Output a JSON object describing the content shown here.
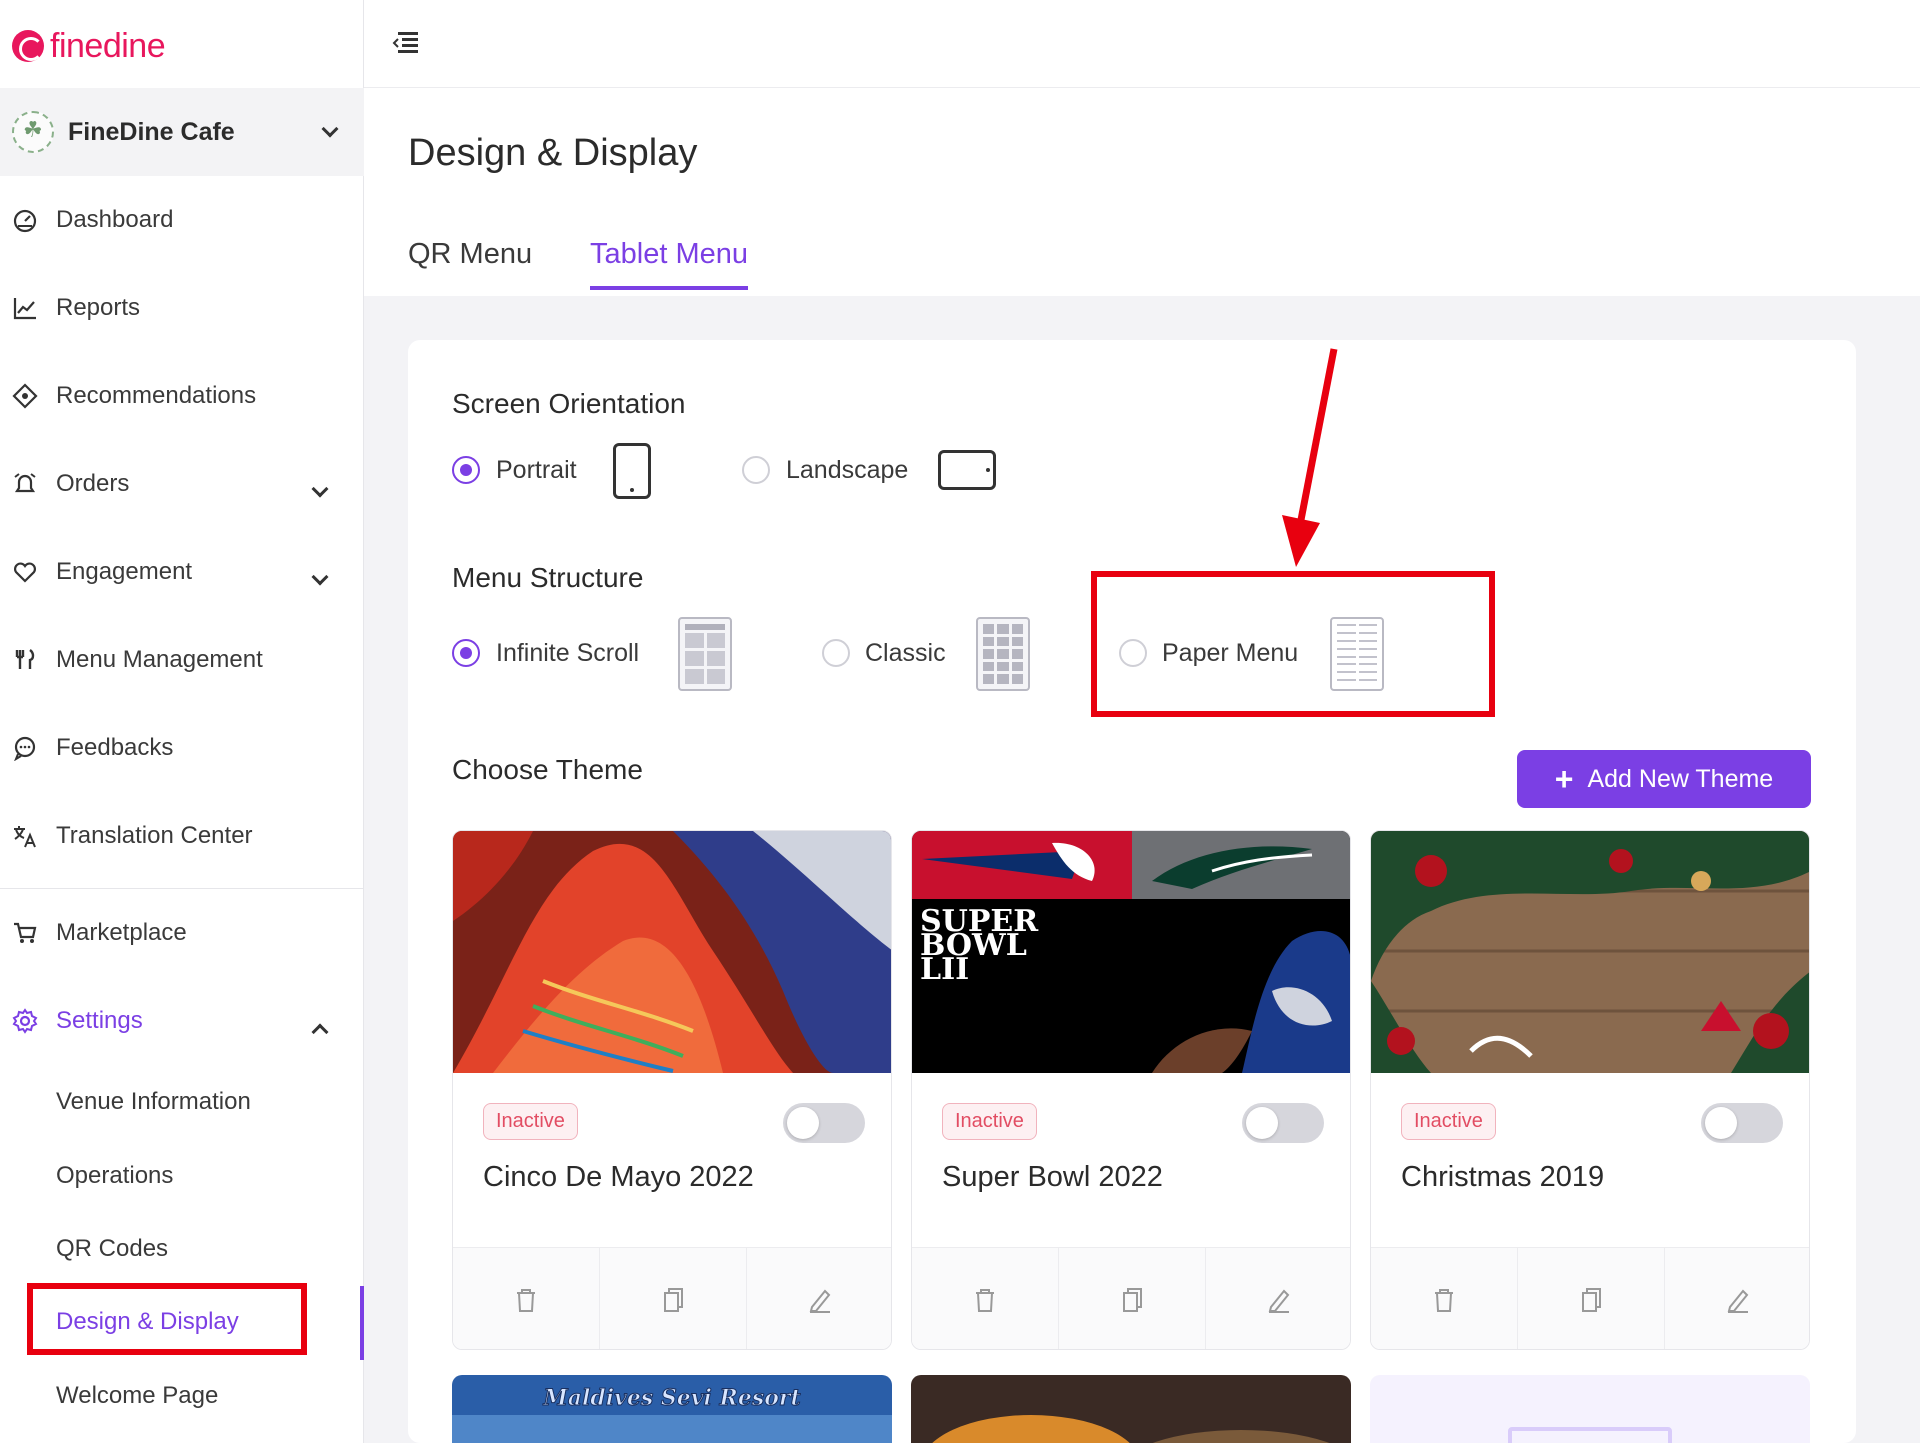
{
  "brand": {
    "name": "finedine",
    "color": "#e8175d"
  },
  "accent_color": "#7b3fe4",
  "venue": {
    "name": "FineDine Cafe"
  },
  "sidebar": {
    "items": [
      {
        "label": "Dashboard",
        "icon": "dashboard-icon"
      },
      {
        "label": "Reports",
        "icon": "chart-line-icon"
      },
      {
        "label": "Recommendations",
        "icon": "recommendations-icon"
      },
      {
        "label": "Orders",
        "icon": "bell-icon",
        "expandable": true
      },
      {
        "label": "Engagement",
        "icon": "heart-icon",
        "expandable": true
      },
      {
        "label": "Menu Management",
        "icon": "fork-knife-icon"
      },
      {
        "label": "Feedbacks",
        "icon": "chat-icon"
      },
      {
        "label": "Translation Center",
        "icon": "translate-icon"
      },
      {
        "label": "Marketplace",
        "icon": "cart-icon"
      },
      {
        "label": "Settings",
        "icon": "gear-icon",
        "expanded": true
      }
    ],
    "settings_sub": [
      {
        "label": "Venue Information"
      },
      {
        "label": "Operations"
      },
      {
        "label": "QR Codes"
      },
      {
        "label": "Design & Display",
        "active": true
      },
      {
        "label": "Welcome Page"
      }
    ]
  },
  "page": {
    "title": "Design & Display",
    "tabs": [
      {
        "label": "QR Menu",
        "active": false
      },
      {
        "label": "Tablet Menu",
        "active": true
      }
    ]
  },
  "screen_orientation": {
    "label": "Screen Orientation",
    "options": [
      {
        "label": "Portrait",
        "selected": true
      },
      {
        "label": "Landscape",
        "selected": false
      }
    ]
  },
  "menu_structure": {
    "label": "Menu Structure",
    "options": [
      {
        "label": "Infinite Scroll",
        "selected": true
      },
      {
        "label": "Classic",
        "selected": false
      },
      {
        "label": "Paper Menu",
        "selected": false
      }
    ]
  },
  "themes": {
    "label": "Choose Theme",
    "add_button": "Add New Theme",
    "items": [
      {
        "name": "Cinco De Mayo 2022",
        "status": "Inactive",
        "enabled": false
      },
      {
        "name": "Super Bowl 2022",
        "status": "Inactive",
        "enabled": false,
        "image_text": "SUPER BOWL LII"
      },
      {
        "name": "Christmas 2019",
        "status": "Inactive",
        "enabled": false
      }
    ],
    "next_row": [
      {
        "image_text": "Maldives Sevi Resort"
      }
    ]
  }
}
